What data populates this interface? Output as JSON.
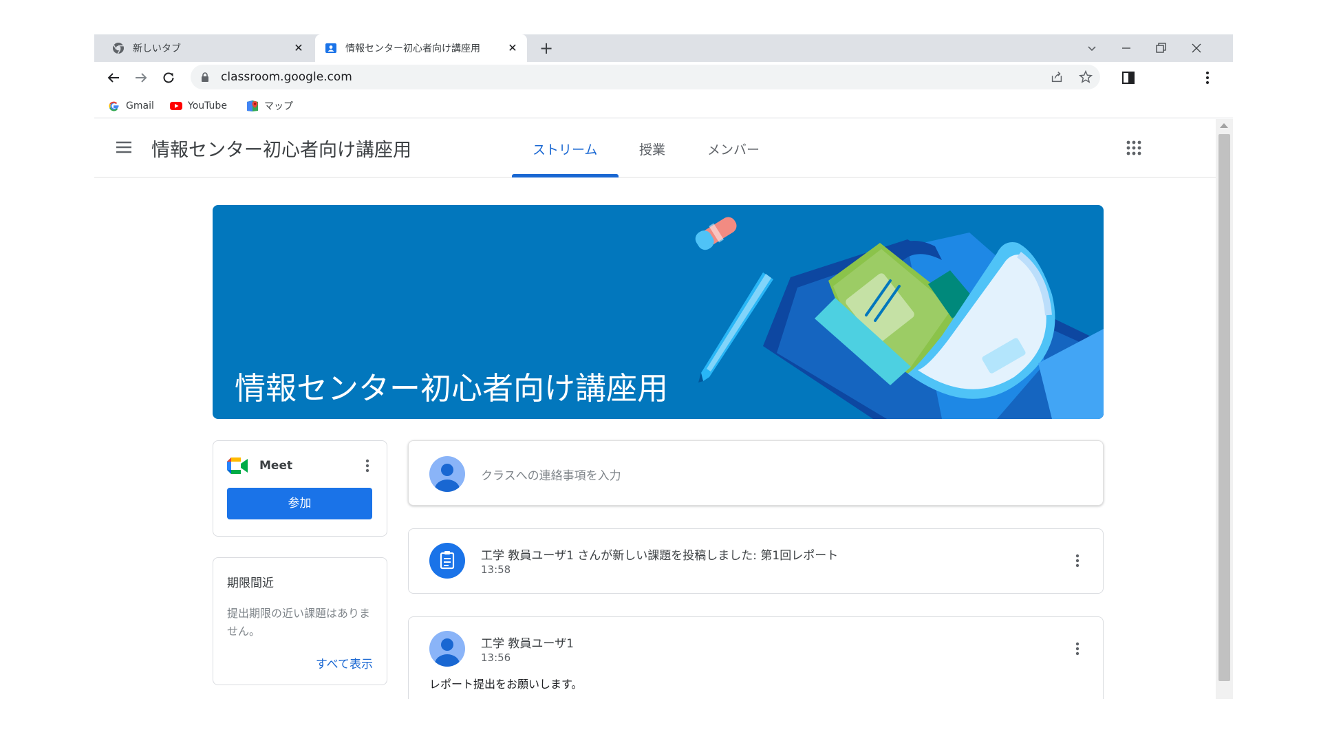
{
  "browser": {
    "tabs": [
      {
        "title": "新しいタブ",
        "active": false
      },
      {
        "title": "情報センター初心者向け講座用",
        "active": true
      }
    ],
    "new_tab": "+",
    "url": "classroom.google.com",
    "bookmarks": [
      {
        "label": "Gmail",
        "icon": "google-icon"
      },
      {
        "label": "YouTube",
        "icon": "youtube-icon"
      },
      {
        "label": "マップ",
        "icon": "maps-icon"
      }
    ]
  },
  "classroom": {
    "course_title": "情報センター初心者向け講座用",
    "nav_tabs": [
      {
        "label": "ストリーム",
        "active": true
      },
      {
        "label": "授業",
        "active": false
      },
      {
        "label": "メンバー",
        "active": false
      }
    ],
    "banner_title": "情報センター初心者向け講座用",
    "meet": {
      "label": "Meet",
      "join_label": "参加"
    },
    "upcoming": {
      "title": "期限間近",
      "empty_text": "提出期限の近い課題はありません。",
      "view_all": "すべて表示"
    },
    "announce_placeholder": "クラスへの連絡事項を入力",
    "posts": [
      {
        "text": "工学 教員ユーザ1 さんが新しい課題を投稿しました: 第1回レポート",
        "time": "13:58",
        "type": "assignment"
      },
      {
        "author": "工学 教員ユーザ1",
        "time": "13:56",
        "body": "レポート提出をお願いします。",
        "type": "announcement"
      }
    ]
  },
  "colors": {
    "accent": "#1967d2",
    "banner": "#0277bd",
    "button": "#1a73e8",
    "tabstrip": "#dee1e6"
  }
}
